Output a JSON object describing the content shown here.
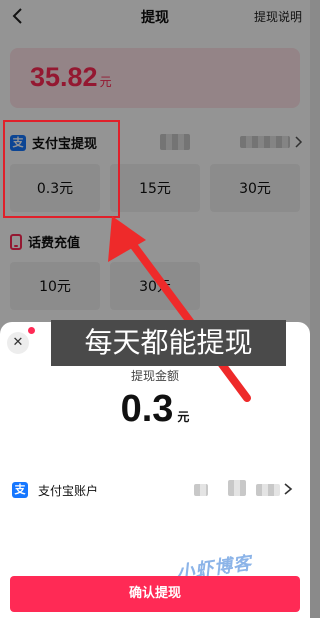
{
  "nav": {
    "title": "提现",
    "explain_label": "提现说明"
  },
  "balance": {
    "amount": "35.82",
    "unit": "元"
  },
  "alipay_section": {
    "label": "支付宝提现",
    "icon": "alipay-icon",
    "options": [
      "0.3元",
      "15元",
      "30元"
    ]
  },
  "phone_section": {
    "label": "话费充值",
    "icon": "phone-icon",
    "options": [
      "10元",
      "30元"
    ]
  },
  "annotation": {
    "banner_text": "每天都能提现",
    "highlight_color": "#e0202a"
  },
  "sheet": {
    "amount_label": "提现金额",
    "amount": "0.3",
    "amount_unit": "元",
    "account_label": "支付宝账户",
    "confirm_label": "确认提现",
    "close_symbol": "✕"
  },
  "watermark": "小虾博客",
  "colors": {
    "accent": "#ff2a55",
    "alipay": "#1677ff"
  }
}
